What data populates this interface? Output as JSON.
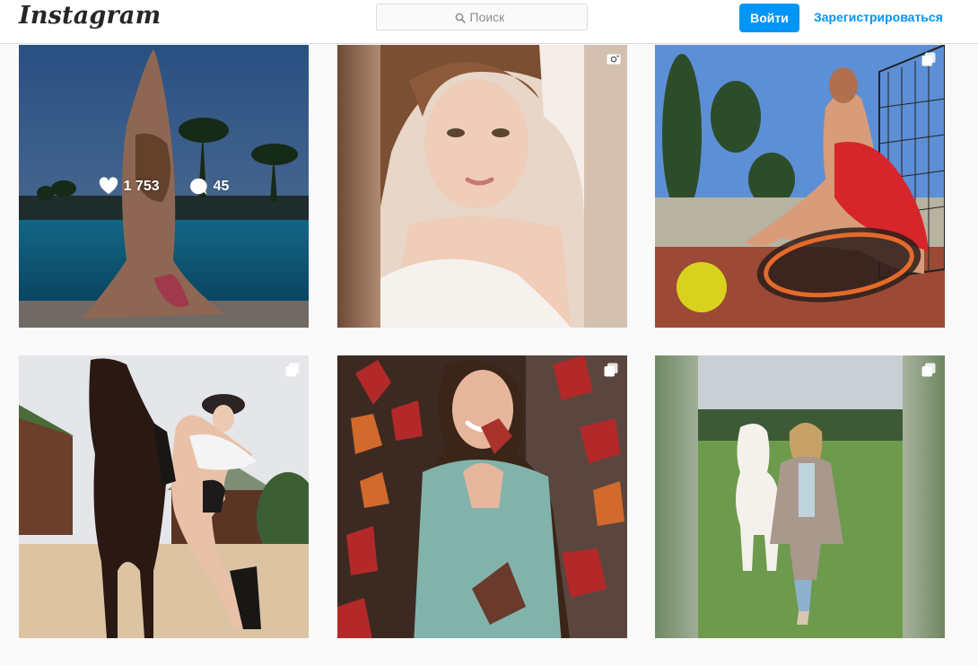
{
  "header": {
    "logo": "Instagram",
    "search_placeholder": "Поиск",
    "login_label": "Войти",
    "signup_label": "Зарегистрироваться"
  },
  "posts": [
    {
      "type": "photo",
      "likes": "1 753",
      "comments": "45",
      "hovered": true
    },
    {
      "type": "video",
      "hovered": false
    },
    {
      "type": "carousel",
      "hovered": false
    },
    {
      "type": "carousel",
      "hovered": false
    },
    {
      "type": "carousel",
      "hovered": false
    },
    {
      "type": "carousel",
      "hovered": false
    }
  ],
  "colors": {
    "accent": "#0095f6",
    "border": "#dbdbdb",
    "background": "#fafafa"
  }
}
